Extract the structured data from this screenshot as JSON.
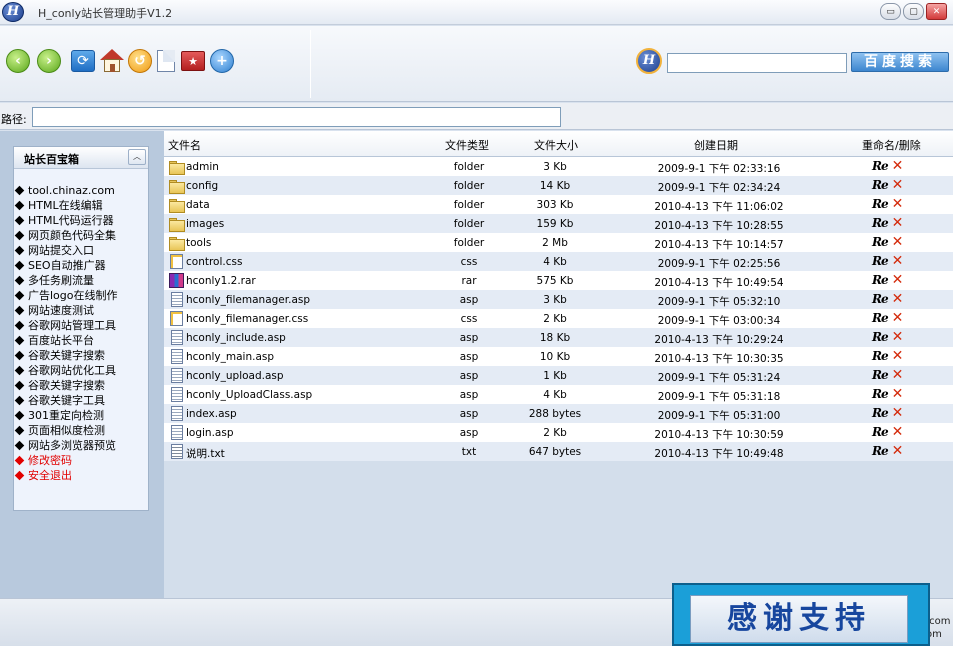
{
  "window": {
    "title": "H_conly站长管理助手V1.2",
    "logo_letter": "H",
    "minimize_glyph": "▭",
    "maximize_glyph": "▢",
    "close_glyph": "✕"
  },
  "toolbar": {
    "back_icon": "back-arrow-icon",
    "forward_icon": "forward-arrow-icon",
    "refresh_icon": "refresh-icon",
    "home_icon": "home-icon",
    "favorites_icon": "favorites-icon",
    "new_file_icon": "new-file-icon",
    "new_folder_icon": "new-folder-icon",
    "add_icon": "add-icon",
    "back_glyph": "‹",
    "forward_glyph": "›",
    "refresh_glyph": "⟳",
    "favorites_glyph": "↺",
    "new_folder_glyph": "★",
    "add_glyph": "+",
    "search_logo_letter": "H",
    "search_value": "",
    "search_button_label": "百度搜索"
  },
  "path": {
    "label": "路径:",
    "value": ""
  },
  "sidebar": {
    "title": "站长百宝箱",
    "collapse_glyph": "︿",
    "items": [
      {
        "label": "tool.chinaz.com",
        "color": "#000000"
      },
      {
        "label": "HTML在线编辑",
        "color": "#000000"
      },
      {
        "label": "HTML代码运行器",
        "color": "#000000"
      },
      {
        "label": "网页颜色代码全集",
        "color": "#000000"
      },
      {
        "label": "网站提交入口",
        "color": "#000000"
      },
      {
        "label": "SEO自动推广器",
        "color": "#000000"
      },
      {
        "label": "多任务刷流量",
        "color": "#000000"
      },
      {
        "label": "广告logo在线制作",
        "color": "#000000"
      },
      {
        "label": "网站速度测试",
        "color": "#000000"
      },
      {
        "label": "谷歌网站管理工具",
        "color": "#000000"
      },
      {
        "label": "百度站长平台",
        "color": "#000000"
      },
      {
        "label": "谷歌关键字搜索",
        "color": "#000000"
      },
      {
        "label": "谷歌网站优化工具",
        "color": "#000000"
      },
      {
        "label": "谷歌关键字搜索",
        "color": "#000000"
      },
      {
        "label": "谷歌关键字工具",
        "color": "#000000"
      },
      {
        "label": "301重定向检测",
        "color": "#000000"
      },
      {
        "label": "页面相似度检测",
        "color": "#000000"
      },
      {
        "label": "网站多浏览器预览",
        "color": "#000000"
      },
      {
        "label": "修改密码",
        "color": "#e10000"
      },
      {
        "label": "安全退出",
        "color": "#e10000"
      }
    ]
  },
  "filelist": {
    "headers": {
      "name": "文件名",
      "type": "文件类型",
      "size": "文件大小",
      "date": "创建日期",
      "actions": "重命名/删除"
    },
    "rename_label": "Re",
    "delete_glyph": "✕",
    "files": [
      {
        "name": "admin",
        "type": "folder",
        "size": "3 Kb",
        "date": "2009-9-1  下午  02:33:16",
        "icon": "folder-icon"
      },
      {
        "name": "config",
        "type": "folder",
        "size": "14 Kb",
        "date": "2009-9-1  下午  02:34:24",
        "icon": "folder-icon"
      },
      {
        "name": "data",
        "type": "folder",
        "size": "303 Kb",
        "date": "2010-4-13  下午  11:06:02",
        "icon": "folder-icon"
      },
      {
        "name": "images",
        "type": "folder",
        "size": "159 Kb",
        "date": "2010-4-13  下午  10:28:55",
        "icon": "folder-icon"
      },
      {
        "name": "tools",
        "type": "folder",
        "size": "2 Mb",
        "date": "2010-4-13  下午  10:14:57",
        "icon": "folder-icon"
      },
      {
        "name": "control.css",
        "type": "css",
        "size": "4 Kb",
        "date": "2009-9-1  下午  02:25:56",
        "icon": "css-file-icon"
      },
      {
        "name": "hconly1.2.rar",
        "type": "rar",
        "size": "575 Kb",
        "date": "2010-4-13  下午  10:49:54",
        "icon": "rar-file-icon"
      },
      {
        "name": "hconly_filemanager.asp",
        "type": "asp",
        "size": "3 Kb",
        "date": "2009-9-1  下午  05:32:10",
        "icon": "asp-file-icon"
      },
      {
        "name": "hconly_filemanager.css",
        "type": "css",
        "size": "2 Kb",
        "date": "2009-9-1  下午  03:00:34",
        "icon": "css-file-icon"
      },
      {
        "name": "hconly_include.asp",
        "type": "asp",
        "size": "18 Kb",
        "date": "2010-4-13  下午  10:29:24",
        "icon": "asp-file-icon"
      },
      {
        "name": "hconly_main.asp",
        "type": "asp",
        "size": "10 Kb",
        "date": "2010-4-13  下午  10:30:35",
        "icon": "asp-file-icon"
      },
      {
        "name": "hconly_upload.asp",
        "type": "asp",
        "size": "1 Kb",
        "date": "2009-9-1  下午  05:31:24",
        "icon": "asp-file-icon"
      },
      {
        "name": "hconly_UploadClass.asp",
        "type": "asp",
        "size": "4 Kb",
        "date": "2009-9-1  下午  05:31:18",
        "icon": "asp-file-icon"
      },
      {
        "name": "index.asp",
        "type": "asp",
        "size": "288 bytes",
        "date": "2009-9-1  下午  05:31:00",
        "icon": "asp-file-icon"
      },
      {
        "name": "login.asp",
        "type": "asp",
        "size": "2 Kb",
        "date": "2010-4-13  下午  10:30:59",
        "icon": "asp-file-icon"
      },
      {
        "name": "说明.txt",
        "type": "txt",
        "size": "647 bytes",
        "date": "2010-4-13  下午  10:49:48",
        "icon": "txt-file-icon"
      }
    ]
  },
  "statusbar": {
    "text_line1": ".com",
    "text_line2": "om"
  },
  "banner": {
    "text": "感谢支持"
  },
  "colors": {
    "accent": "#1b9fd8",
    "danger": "#d42b0c",
    "row_alt": "#e4ebf5"
  }
}
